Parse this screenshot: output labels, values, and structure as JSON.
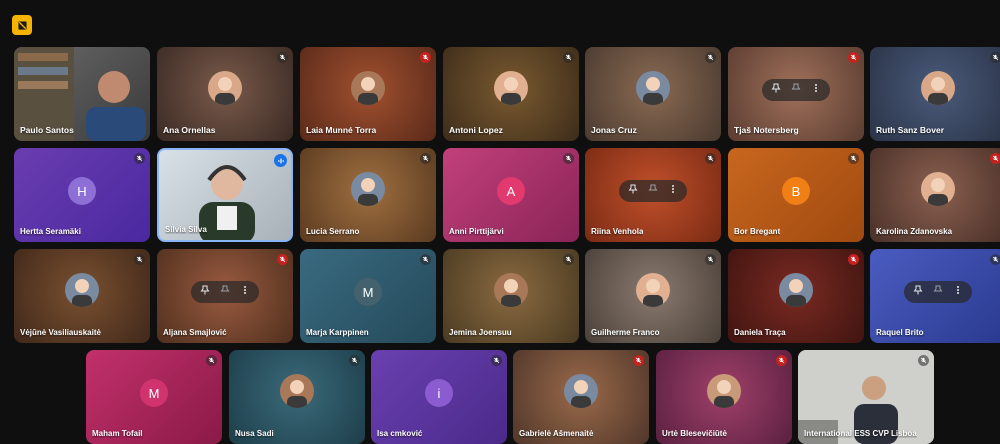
{
  "app": {
    "top_badge_icon": "meeting-badge-icon",
    "accent": "#f6b400"
  },
  "participants": [
    {
      "name": "Paulo Santos",
      "kind": "video",
      "mic": "none"
    },
    {
      "name": "Ana Ornellas",
      "kind": "photo",
      "mic": "muted"
    },
    {
      "name": "Laia Munné Torra",
      "kind": "photo",
      "mic": "muted-red"
    },
    {
      "name": "Antoni Lopez",
      "kind": "photo",
      "mic": "muted"
    },
    {
      "name": "Jonas Cruz",
      "kind": "photo",
      "mic": "muted"
    },
    {
      "name": "Tjaš Notersberg",
      "kind": "hover",
      "mic": "muted-red"
    },
    {
      "name": "Ruth Sanz Bover",
      "kind": "photo",
      "mic": "muted"
    },
    {
      "name": "Hertta Seramäki",
      "kind": "letter",
      "letter": "H",
      "mic": "muted"
    },
    {
      "name": "Silvia Silva",
      "kind": "video",
      "mic": "speaking"
    },
    {
      "name": "Lucia Serrano",
      "kind": "photo",
      "mic": "muted"
    },
    {
      "name": "Anni Pirttijärvi",
      "kind": "letter",
      "letter": "A",
      "mic": "muted"
    },
    {
      "name": "Riina Venhola",
      "kind": "hover",
      "mic": "muted"
    },
    {
      "name": "Bor Bregant",
      "kind": "letter",
      "letter": "B",
      "mic": "muted"
    },
    {
      "name": "Karolina Zdanovska",
      "kind": "photo",
      "mic": "muted-red"
    },
    {
      "name": "Vėjūnė Vasiliauskaitė",
      "kind": "photo",
      "mic": "muted"
    },
    {
      "name": "Aljana Smajlović",
      "kind": "hover",
      "mic": "muted-red"
    },
    {
      "name": "M",
      "kind": "letter",
      "letter": "M",
      "mic": "muted"
    },
    {
      "name": "Jemina Joensuu",
      "kind": "photo",
      "mic": "muted"
    },
    {
      "name": "Guilherme Franco",
      "kind": "photo",
      "mic": "muted"
    },
    {
      "name": "Daniela Traça",
      "kind": "photo",
      "mic": "muted-red"
    },
    {
      "name": "Raquel Brito",
      "kind": "hover",
      "mic": "muted"
    },
    {
      "name": "Maham Tofail",
      "kind": "letter",
      "letter": "M",
      "mic": "muted"
    },
    {
      "name": "Nusa Sadi",
      "kind": "photo",
      "mic": "muted"
    },
    {
      "name": "Isa cmković",
      "kind": "letter",
      "letter": "i",
      "mic": "muted"
    },
    {
      "name": "Gabrielė Ašmenaitė",
      "kind": "photo",
      "mic": "muted-red"
    },
    {
      "name": "Urtė Blesevičiūtė",
      "kind": "photo",
      "mic": "muted-red"
    },
    {
      "name": "International ESS CVP Lisboa",
      "kind": "video",
      "mic": "muted"
    }
  ],
  "overrides": {
    "m_tile_name": "Marja Karppinen"
  },
  "colors": {
    "bg": "#0f0f0f",
    "speaking_border": "#8ab4f8",
    "mute_red": "#c5221f"
  }
}
